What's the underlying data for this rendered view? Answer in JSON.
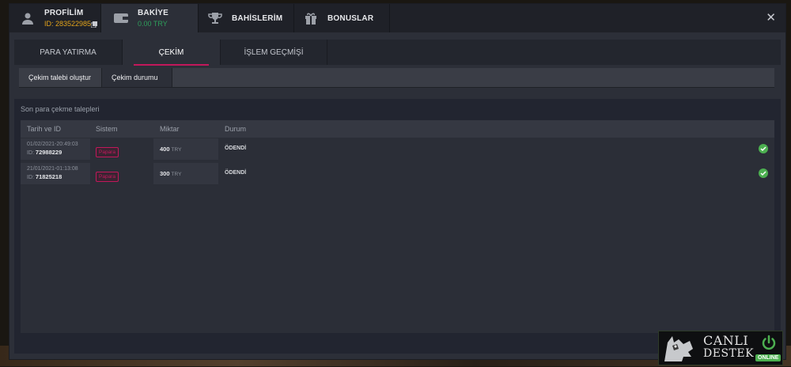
{
  "header": {
    "profile": {
      "label": "PROFİLİM",
      "id_text": "ID: 283522985",
      "icon": "user-icon"
    },
    "balance": {
      "label": "BAKİYE",
      "amount": "0.00 TRY",
      "icon": "wallet-icon"
    },
    "bets": {
      "label": "BAHİSLERİM",
      "icon": "trophy-icon"
    },
    "bonuses": {
      "label": "BONUSLAR",
      "icon": "gift-icon"
    },
    "close": "✕"
  },
  "tabs": [
    "PARA YATIRMA",
    "ÇEKİM",
    "İŞLEM GEÇMİŞİ"
  ],
  "active_tab": "ÇEKİM",
  "subtabs": [
    "Çekim talebi oluştur",
    "Çekim durumu"
  ],
  "active_subtab": "Çekim durumu",
  "section_title": "Son para çekme talepleri",
  "table": {
    "columns": [
      "Tarih ve ID",
      "Sistem",
      "Miktar",
      "Durum"
    ],
    "rows": [
      {
        "date": "01/02/2021-20:49:03",
        "id_label": "ID:",
        "id": "72988229",
        "system": "Papara",
        "amount": "400",
        "currency": "TRY",
        "status": "ÖDENDİ"
      },
      {
        "date": "21/01/2021-01:13:08",
        "id_label": "ID:",
        "id": "71825218",
        "system": "Papara",
        "amount": "300",
        "currency": "TRY",
        "status": "ÖDENDİ"
      }
    ]
  },
  "support": {
    "line1": "CANLI",
    "line2": "DESTEK",
    "status": "ONLINE"
  },
  "colors": {
    "accent": "#c2185b",
    "success": "#4caf50",
    "balance": "#2e9e5b",
    "profile_id": "#e3a41a"
  }
}
